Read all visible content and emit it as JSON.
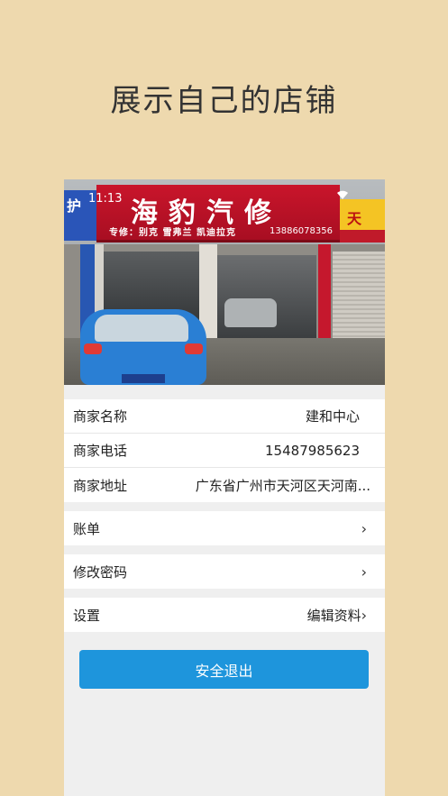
{
  "headline": "展示自己的店铺",
  "status": {
    "time": "11:13"
  },
  "photo": {
    "sign_title": "海豹汽修",
    "sign_subtitle": "专修：别克 雪弗兰 凯迪拉克",
    "sign_phone": "13886078356",
    "side_sign_left": "护",
    "side_sign_right": "天"
  },
  "merchant": {
    "name_label": "商家名称",
    "name_value": "建和中心",
    "phone_label": "商家电话",
    "phone_value": "15487985623",
    "address_label": "商家地址",
    "address_value": "广东省广州市天河区天河南..."
  },
  "menu": {
    "bill_label": "账单",
    "password_label": "修改密码",
    "settings_label": "设置",
    "settings_hint": "编辑资料"
  },
  "logout_label": "安全退出",
  "colors": {
    "background": "#EED9AE",
    "accent": "#1E95DC"
  }
}
